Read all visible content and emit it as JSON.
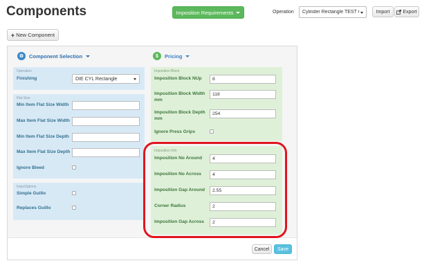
{
  "header": {
    "title": "Components",
    "imposition_button": "Imposition Requirements",
    "operation_label": "Operation",
    "operation_value": "Cylinder Rectangle TEST Ol",
    "import_button": "Import",
    "export_button": "Export",
    "export_icon": "export-icon"
  },
  "toolbar": {
    "new_component_button": "New Component",
    "new_component_icon": "plus-icon"
  },
  "component_selection": {
    "heading": "Component Selection",
    "icon": "cogs-icon",
    "operation_group": {
      "caption": "Operation",
      "finishing_label": "Finishing",
      "finishing_value": "DIE CYL Rectangle"
    },
    "flat_size_group": {
      "caption": "Flat Size",
      "min_width_label": "Min Item Flat Size Width",
      "max_width_label": "Max Item Flat Size Width",
      "min_depth_label": "Min Item Flat Size Depth",
      "max_depth_label": "Max Item Flat Size Depth",
      "ignore_bleed_label": "Ignore Bleed"
    },
    "impo_options_group": {
      "caption": "ImpoOptions",
      "simple_guillo_label": "Simple Guillo",
      "replaces_guillo_label": "Replaces Guillo"
    }
  },
  "pricing": {
    "heading": "Pricing",
    "icon": "dollar-icon",
    "imposition_block": {
      "caption": "Imposition Block",
      "nup_label": "Imposition Block NUp",
      "nup_value": "8",
      "width_label": "Imposition Block Width mm",
      "width_value": "118",
      "depth_label": "Imposition Block Depth mm",
      "depth_value": "254",
      "ignore_grips_label": "Ignore Press Grips"
    },
    "imposition_info": {
      "caption": "Imposition Info",
      "no_around_label": "Imposition No Around",
      "no_around_value": "4",
      "no_across_label": "Imposition No Across",
      "no_across_value": "4",
      "gap_around_label": "Imposition Gap Around",
      "gap_around_value": "2.55",
      "corner_radius_label": "Corner Radius",
      "corner_radius_value": "2",
      "gap_across_label": "Imposition Gap Across",
      "gap_across_value": "2"
    }
  },
  "footer": {
    "cancel_button": "Cancel",
    "save_button": "Save"
  },
  "colors": {
    "primary_green": "#5cb85c",
    "save_blue": "#5bc0de",
    "highlight_red": "#e0141e"
  }
}
